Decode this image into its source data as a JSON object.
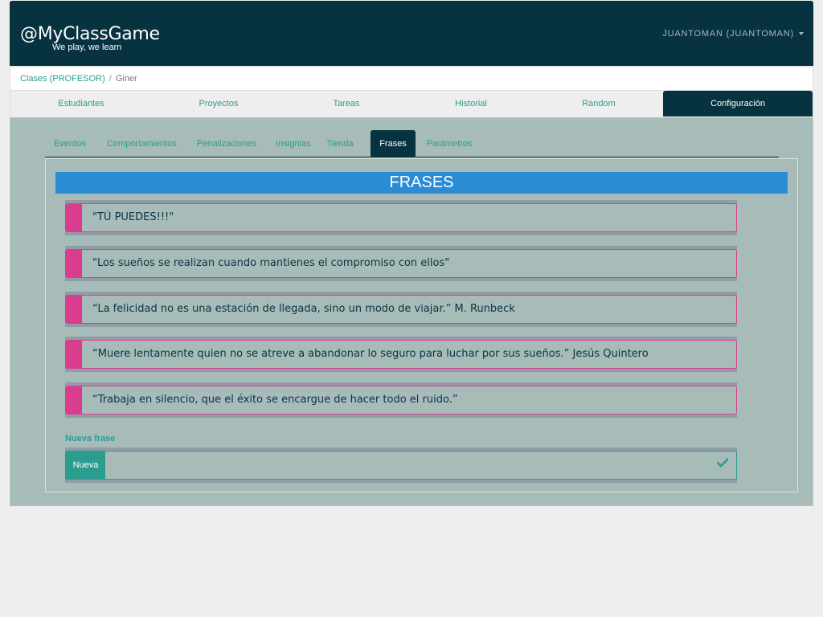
{
  "navbar": {
    "brand": "@MyClassGame",
    "tagline": "We play, we learn",
    "user": "JUANTOMAN (JUANTOMAN)"
  },
  "breadcrumb": {
    "classes": "Clases (PROFESOR)",
    "separator": "/",
    "current": "Giner"
  },
  "main_tabs": {
    "students": "Estudiantes",
    "projects": "Proyectos",
    "tasks": "Tareas",
    "history": "Historial",
    "random": "Random",
    "config": "Configuración"
  },
  "sub_tabs": {
    "events": "Eventos",
    "behaviors": "Comportamientos",
    "penalties": "Penalizaciones",
    "badges": "Insignias",
    "shop": "Tienda",
    "phrases": "Frases",
    "parameters": "Parámetros"
  },
  "section": {
    "title": "FRASES"
  },
  "phrases": [
    "\"TÚ PUEDES!!!\"",
    "\"Los sueños se realizan cuando mantienes el compromiso con ellos\"",
    "“La felicidad no es una estación de llegada, sino un modo de viajar.” M. Runbeck",
    "“Muere lentamente quien no se atreve a abandonar lo seguro para luchar por sus sueños.” Jesús Quintero",
    "“Trabaja en silencio, que el éxito se encargue de hacer todo el ruido.”"
  ],
  "new_phrase": {
    "label": "Nueva frase",
    "button": "Nueva",
    "value": ""
  },
  "icons": {
    "user_menu": "chevron-down-icon",
    "submit": "check-icon"
  },
  "colors": {
    "navbar": "#073240",
    "accent": "#2a9d8f",
    "title_bar": "#2b8cd6",
    "phrase_marker": "#d93e8e",
    "panel": "#a7bbb9"
  }
}
